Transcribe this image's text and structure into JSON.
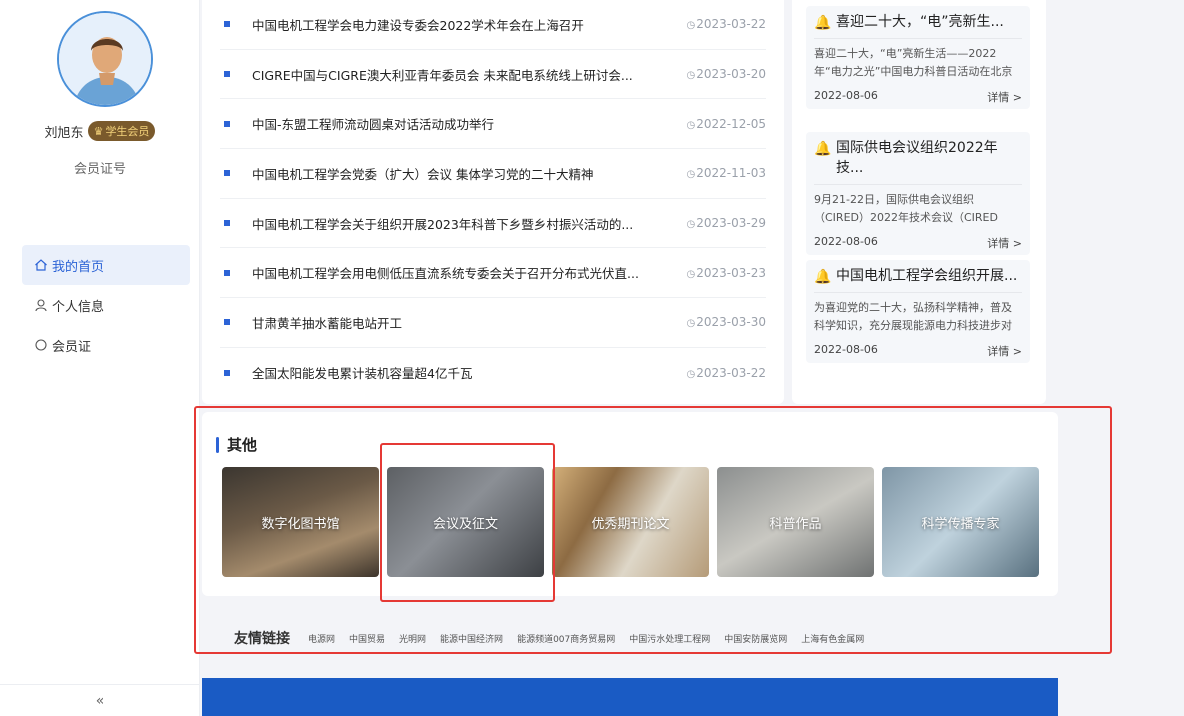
{
  "user": {
    "name": "刘旭东",
    "badge": "学生会员",
    "member_no_label": "会员证号"
  },
  "nav": {
    "items": [
      {
        "label": "我的首页",
        "icon": "home-icon",
        "active": true
      },
      {
        "label": "个人信息",
        "icon": "user-icon",
        "active": false
      },
      {
        "label": "会员证",
        "icon": "circle-icon",
        "active": false
      }
    ],
    "collapse": "«"
  },
  "news": [
    {
      "title": "中国电机工程学会电力建设专委会2022学术年会在上海召开",
      "date": "2023-03-22"
    },
    {
      "title": "CIGRE中国与CIGRE澳大利亚青年委员会 未来配电系统线上研讨会...",
      "date": "2023-03-20"
    },
    {
      "title": "中国-东盟工程师流动圆桌对话活动成功举行",
      "date": "2022-12-05"
    },
    {
      "title": "中国电机工程学会党委（扩大）会议 集体学习党的二十大精神",
      "date": "2022-11-03"
    },
    {
      "title": "中国电机工程学会关于组织开展2023年科普下乡暨乡村振兴活动的...",
      "date": "2023-03-29"
    },
    {
      "title": "中国电机工程学会用电侧低压直流系统专委会关于召开分布式光伏直...",
      "date": "2023-03-23"
    },
    {
      "title": "甘肃黄羊抽水蓄能电站开工",
      "date": "2023-03-30"
    },
    {
      "title": "全国太阳能发电累计装机容量超4亿千瓦",
      "date": "2023-03-22"
    }
  ],
  "notices": [
    {
      "title": "喜迎二十大，“电”亮新生...",
      "body": "喜迎二十大，“电”亮新生活——2022年“电力之光”中国电力科普日活动在北京开",
      "date": "2022-08-06",
      "more": "详情 >"
    },
    {
      "title": "国际供电会议组织2022年技...",
      "body": "9月21-22日，国际供电会议组织（CIRED）2022年技术会议（CIRED",
      "date": "2022-08-06",
      "more": "详情 >"
    },
    {
      "title": "中国电机工程学会组织开展...",
      "body": "为喜迎党的二十大，弘扬科学精神，普及科学知识，充分展现能源电力科技进步对",
      "date": "2022-08-06",
      "more": "详情 >"
    }
  ],
  "others": {
    "title": "其他",
    "tiles": [
      "数字化图书馆",
      "会议及征文",
      "优秀期刊论文",
      "科普作品",
      "科学传播专家"
    ]
  },
  "links": {
    "title": "友情链接",
    "items": [
      "电源网",
      "中国贸易",
      "光明网",
      "能源中国经济网",
      "能源频道007商务贸易网",
      "中国污水处理工程网",
      "中国安防展览网",
      "上海有色金属网"
    ]
  },
  "colors": {
    "accent": "#2c63d6",
    "highlight": "#e53935",
    "footer": "#1a5bc4"
  }
}
